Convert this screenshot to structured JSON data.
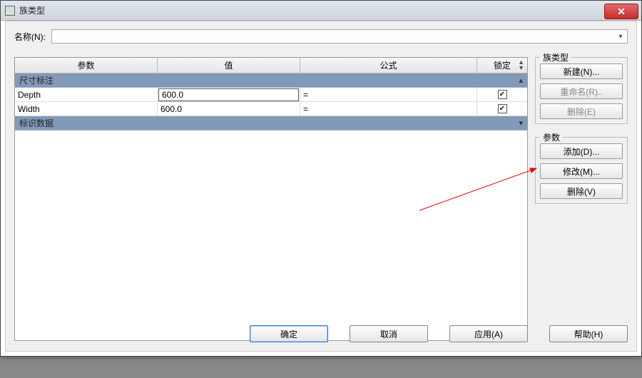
{
  "window": {
    "title": "族类型"
  },
  "name": {
    "label": "名称(N):",
    "value": ""
  },
  "columns": {
    "param": "参数",
    "value": "值",
    "formula": "公式",
    "lock": "锁定"
  },
  "groups": {
    "dim": "尺寸标注",
    "identity": "标识数据"
  },
  "rows": [
    {
      "param": "Depth",
      "value": "600.0",
      "formula": "=",
      "lock": true,
      "editing": true
    },
    {
      "param": "Width",
      "value": "600.0",
      "formula": "=",
      "lock": true,
      "editing": false
    }
  ],
  "side": {
    "type_group": "族类型",
    "new": "新建(N)...",
    "rename": "重命名(R)..",
    "delete_type": "删除(E)",
    "param_group": "参数",
    "add": "添加(D)...",
    "modify": "修改(M)...",
    "delete_param": "删除(V)"
  },
  "bottom": {
    "ok": "确定",
    "cancel": "取消",
    "apply": "应用(A)",
    "help": "帮助(H)"
  }
}
